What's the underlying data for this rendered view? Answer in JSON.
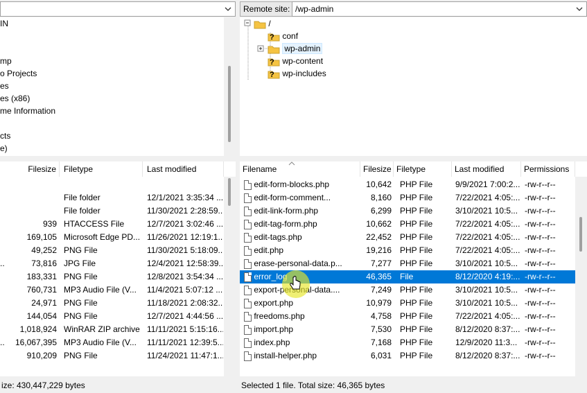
{
  "local": {
    "tree": [
      "IN",
      "mp",
      "o Projects",
      "es",
      "es (x86)",
      "me Information",
      "cts",
      "e)"
    ],
    "columns": [
      "Filesize",
      "Filetype",
      "Last modified"
    ],
    "rows": [
      {
        "name": "",
        "size": "",
        "type": "File folder",
        "modified": "12/1/2021 3:35:34 ..."
      },
      {
        "name": "",
        "size": "",
        "type": "File folder",
        "modified": "11/30/2021 2:28:59..."
      },
      {
        "name": "",
        "size": "939",
        "type": "HTACCESS File",
        "modified": "12/7/2021 3:02:46 ..."
      },
      {
        "name": "",
        "size": "169,105",
        "type": "Microsoft Edge PD...",
        "modified": "11/26/2021 12:19:1..."
      },
      {
        "name": "",
        "size": "49,252",
        "type": "PNG File",
        "modified": "11/30/2021 5:18:09..."
      },
      {
        "name": "..",
        "size": "73,816",
        "type": "JPG File",
        "modified": "12/4/2021 12:58:39..."
      },
      {
        "name": "",
        "size": "183,331",
        "type": "PNG File",
        "modified": "12/8/2021 3:54:34 ..."
      },
      {
        "name": "",
        "size": "760,731",
        "type": "MP3 Audio File (V...",
        "modified": "11/4/2021 5:07:12 ..."
      },
      {
        "name": "",
        "size": "24,971",
        "type": "PNG File",
        "modified": "11/18/2021 2:08:32..."
      },
      {
        "name": "",
        "size": "144,054",
        "type": "PNG File",
        "modified": "12/7/2021 4:44:56 ..."
      },
      {
        "name": "",
        "size": "1,018,924",
        "type": "WinRAR ZIP archive",
        "modified": "11/11/2021 5:15:16..."
      },
      {
        "name": "..",
        "size": "16,067,395",
        "type": "MP3 Audio File (V...",
        "modified": "11/11/2021 12:39:5..."
      },
      {
        "name": "",
        "size": "910,209",
        "type": "PNG File",
        "modified": "11/24/2021 11:47:1..."
      }
    ],
    "status": "ize: 430,447,229 bytes"
  },
  "remote": {
    "label": "Remote site:",
    "path": "/wp-admin",
    "tree": {
      "root": "/",
      "children": [
        "conf",
        "wp-admin",
        "wp-content",
        "wp-includes"
      ]
    },
    "columns": [
      "Filename",
      "Filesize",
      "Filetype",
      "Last modified",
      "Permissions"
    ],
    "rows": [
      {
        "name": "edit-form-blocks.php",
        "size": "10,642",
        "type": "PHP File",
        "modified": "9/9/2021 7:00:2...",
        "perms": "-rw-r--r--"
      },
      {
        "name": "edit-form-comment...",
        "size": "8,160",
        "type": "PHP File",
        "modified": "7/22/2021 4:05:...",
        "perms": "-rw-r--r--"
      },
      {
        "name": "edit-link-form.php",
        "size": "6,299",
        "type": "PHP File",
        "modified": "3/10/2021 10:5...",
        "perms": "-rw-r--r--"
      },
      {
        "name": "edit-tag-form.php",
        "size": "10,662",
        "type": "PHP File",
        "modified": "7/22/2021 4:05:...",
        "perms": "-rw-r--r--"
      },
      {
        "name": "edit-tags.php",
        "size": "22,452",
        "type": "PHP File",
        "modified": "7/22/2021 4:05:...",
        "perms": "-rw-r--r--"
      },
      {
        "name": "edit.php",
        "size": "19,216",
        "type": "PHP File",
        "modified": "7/22/2021 4:05:...",
        "perms": "-rw-r--r--"
      },
      {
        "name": "erase-personal-data.p...",
        "size": "7,277",
        "type": "PHP File",
        "modified": "3/10/2021 10:5...",
        "perms": "-rw-r--r--"
      },
      {
        "name": "error_log",
        "size": "46,365",
        "type": "File",
        "modified": "8/12/2020 4:19:...",
        "perms": "-rw-r--r--"
      },
      {
        "name": "export-personal-data....",
        "size": "7,249",
        "type": "PHP File",
        "modified": "3/10/2021 10:5...",
        "perms": "-rw-r--r--"
      },
      {
        "name": "export.php",
        "size": "10,979",
        "type": "PHP File",
        "modified": "3/10/2021 10:5...",
        "perms": "-rw-r--r--"
      },
      {
        "name": "freedoms.php",
        "size": "4,758",
        "type": "PHP File",
        "modified": "7/22/2021 4:05:...",
        "perms": "-rw-r--r--"
      },
      {
        "name": "import.php",
        "size": "7,530",
        "type": "PHP File",
        "modified": "8/12/2020 8:37:...",
        "perms": "-rw-r--r--"
      },
      {
        "name": "index.php",
        "size": "7,168",
        "type": "PHP File",
        "modified": "12/9/2020 11:3...",
        "perms": "-rw-r--r--"
      },
      {
        "name": "install-helper.php",
        "size": "6,031",
        "type": "PHP File",
        "modified": "8/12/2020 8:37:...",
        "perms": "-rw-r--r--"
      }
    ],
    "selected_index": 7,
    "status": "Selected 1 file. Total size: 46,365 bytes"
  },
  "colors": {
    "selection": "#0078d7",
    "folder": "#f5c342",
    "cursor_highlight": "#e6e628"
  }
}
